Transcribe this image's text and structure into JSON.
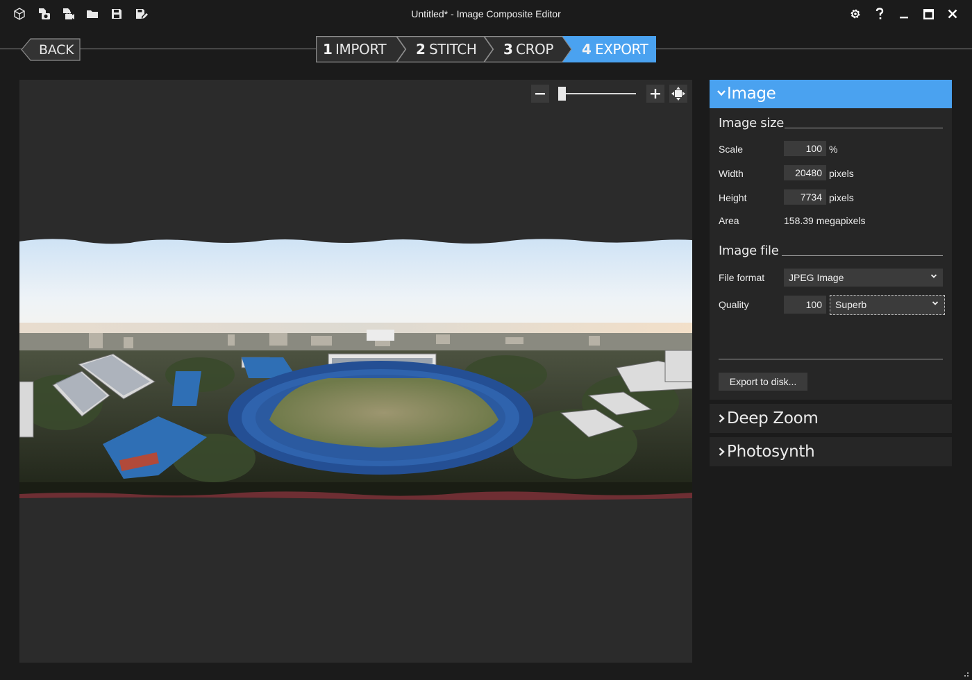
{
  "window": {
    "title": "Untitled* - Image Composite Editor",
    "toolbar_icons": [
      "cube-icon",
      "new-panorama-from-images-icon",
      "new-panorama-from-video-icon",
      "open-folder-icon",
      "save-icon",
      "save-as-icon"
    ],
    "controls": [
      "settings-gear-icon",
      "help-icon",
      "minimize-icon",
      "maximize-icon",
      "close-icon"
    ]
  },
  "workflow": {
    "back_label": "BACK",
    "steps": [
      {
        "num": "1",
        "name": "IMPORT",
        "active": false
      },
      {
        "num": "2",
        "name": "STITCH",
        "active": false
      },
      {
        "num": "3",
        "name": "CROP",
        "active": false
      },
      {
        "num": "4",
        "name": "EXPORT",
        "active": true
      }
    ]
  },
  "viewer": {
    "zoom_level": 0.04,
    "buttons": [
      "zoom-out",
      "zoom-in",
      "fit-to-window"
    ]
  },
  "panel": {
    "image_section": {
      "title": "Image",
      "expanded": true,
      "image_size": {
        "title": "Image size",
        "scale_label": "Scale",
        "scale_value": "100",
        "scale_unit": "%",
        "width_label": "Width",
        "width_value": "20480",
        "width_unit": "pixels",
        "height_label": "Height",
        "height_value": "7734",
        "height_unit": "pixels",
        "area_label": "Area",
        "area_value": "158.39 megapixels"
      },
      "image_file": {
        "title": "Image file",
        "format_label": "File format",
        "format_value": "JPEG Image",
        "quality_label": "Quality",
        "quality_value": "100",
        "quality_preset": "Superb"
      },
      "export_button": "Export to disk..."
    },
    "deep_zoom": {
      "title": "Deep Zoom",
      "expanded": false
    },
    "photosynth": {
      "title": "Photosynth",
      "expanded": false
    }
  },
  "colors": {
    "accent": "#4aa2f0",
    "window_bg": "#1b1b1b",
    "canvas_bg": "#2b2b2b",
    "panel_bg": "#262626",
    "field_bg": "#3b3b3b"
  }
}
